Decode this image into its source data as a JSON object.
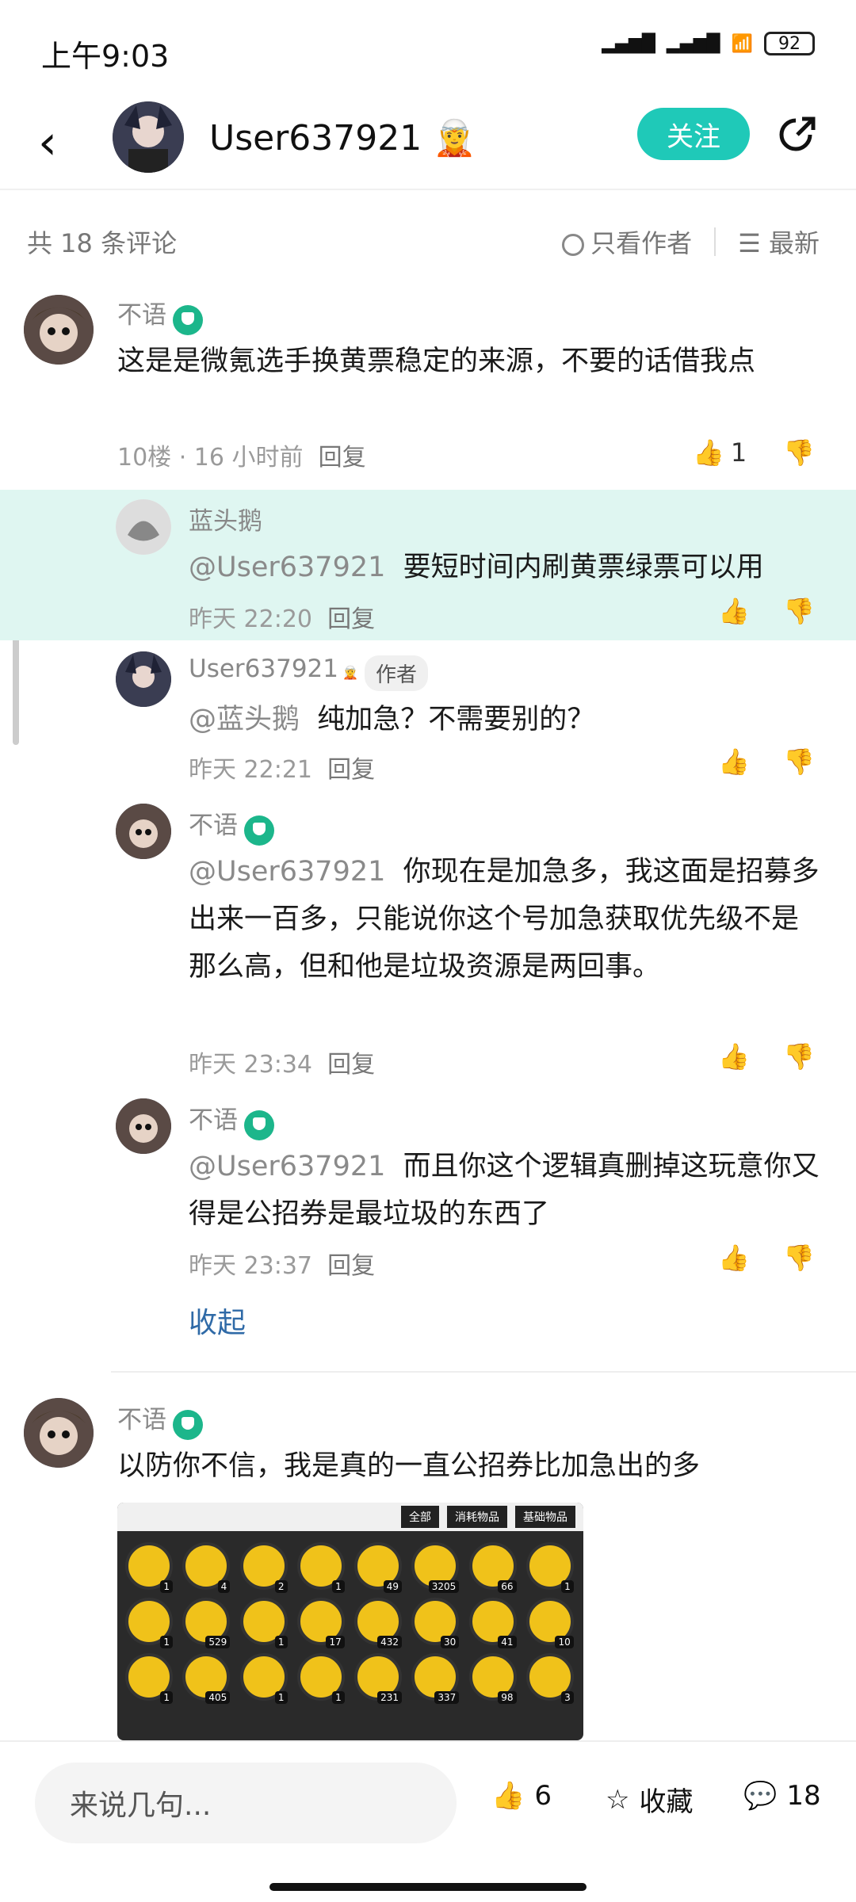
{
  "status_bar": {
    "time": "上午9:03",
    "battery": "92"
  },
  "header": {
    "username": "User637921",
    "follow_label": "关注"
  },
  "comments_bar": {
    "count": "共 18 条评论",
    "author_only": "只看作者",
    "sort": "最新"
  },
  "comments": [
    {
      "name": "不语",
      "text": "这是是微氪选手换黄票稳定的来源，不要的话借我点",
      "meta": "10楼 · 16 小时前",
      "reply_label": "回复",
      "likes": "1"
    },
    {
      "name": "不语",
      "text": "以防你不信，我是真的一直公招券比加急出的多"
    }
  ],
  "replies": [
    {
      "name": "蓝头鹅",
      "mention": "@User637921",
      "text": "要短时间内刷黄票绿票可以用",
      "time": "昨天 22:20",
      "reply_label": "回复"
    },
    {
      "name": "User637921",
      "author_tag": "作者",
      "mention": "@蓝头鹅",
      "text": "纯加急？不需要别的？",
      "time": "昨天 22:21",
      "reply_label": "回复"
    },
    {
      "name": "不语",
      "mention": "@User637921",
      "text": "你现在是加急多，我这面是招募多出来一百多，只能说你这个号加急获取优先级不是那么高，但和他是垃圾资源是两回事。",
      "time": "昨天 23:34",
      "reply_label": "回复"
    },
    {
      "name": "不语",
      "mention": "@User637921",
      "text": "而且你这个逻辑真删掉这玩意你又得是公招券是最垃圾的东西了",
      "time": "昨天 23:37",
      "reply_label": "回复"
    }
  ],
  "collapse_label": "收起",
  "screenshot_tabs": [
    "全部",
    "消耗物品",
    "基础物品"
  ],
  "screenshot_counts": [
    "1",
    "4",
    "2",
    "1",
    "49",
    "3205",
    "66",
    "1",
    "1",
    "529",
    "1",
    "17",
    "432",
    "30",
    "41",
    "10",
    "1",
    "405",
    "1",
    "1",
    "231",
    "337",
    "98",
    "3"
  ],
  "bottom_bar": {
    "input_placeholder": "来说几句...",
    "like_count": "6",
    "favorite_label": "收藏",
    "comment_count": "18"
  },
  "colors": {
    "accent": "#1fc9b8",
    "highlight": "#dff6f1",
    "link": "#2f6aa7",
    "badge": "#1cb68b"
  }
}
